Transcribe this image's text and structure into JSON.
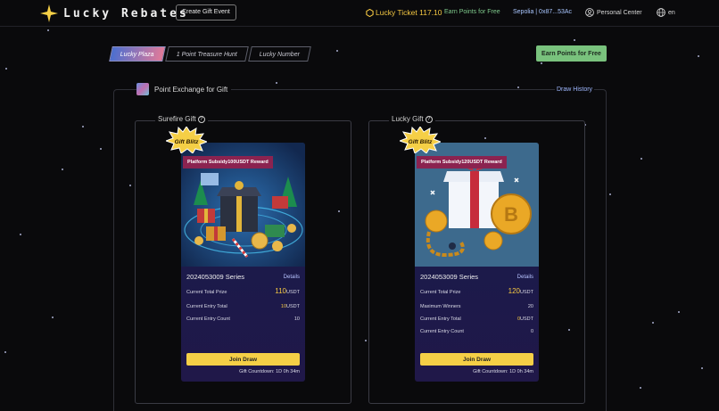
{
  "header": {
    "logo_text": "Lucky Rebates",
    "create_button": "Create Gift Event",
    "ticket_text": "Lucky Ticket 117.10",
    "earn_link": "Earn Points for Free",
    "wallet": "Sepolia | 0x87...53Ac",
    "personal": "Personal Center",
    "language": "en"
  },
  "tabs": [
    "Lucky Plaza",
    "1 Point Treasure Hunt",
    "Lucky Number"
  ],
  "earn_button": "Earn Points for Free",
  "panel": {
    "title": "Point Exchange for Gift",
    "draw_history": "Draw History"
  },
  "surefire": {
    "section_title": "Surefire Gift",
    "badge": "Gift Blitz",
    "subsidy": "Platform Subsidy100USDT Reward",
    "series": "2024053009 Series",
    "details": "Details",
    "prize_label": "Current Total Prize",
    "prize_value": "110",
    "prize_unit": "USDT",
    "entry_total_label": "Current Entry Total",
    "entry_total_value": "10",
    "entry_total_unit": "USDT",
    "entry_count_label": "Current Entry Count",
    "entry_count_value": "10",
    "join": "Join Draw",
    "countdown": "Gift Countdown:  1D 0h 34m"
  },
  "lucky": {
    "section_title": "Lucky Gift",
    "badge": "Gift Blitz",
    "subsidy": "Platform Subsidy120USDT Reward",
    "series": "2024053009 Series",
    "details": "Details",
    "prize_label": "Current Total Prize",
    "prize_value": "120",
    "prize_unit": "USDT",
    "winners_label": "Maximum Winners",
    "winners_value": "20",
    "entry_total_label": "Current Entry Total",
    "entry_total_value": "0",
    "entry_total_unit": "USDT",
    "entry_count_label": "Current Entry Count",
    "entry_count_value": "0",
    "join": "Join Draw",
    "countdown": "Gift Countdown:  1D 0h 34m"
  },
  "colors": {
    "accent_gold": "#f5cf46",
    "earn_green": "#79c27d",
    "subsidy_red": "#8b2350",
    "link_blue": "#9fb8ff"
  }
}
